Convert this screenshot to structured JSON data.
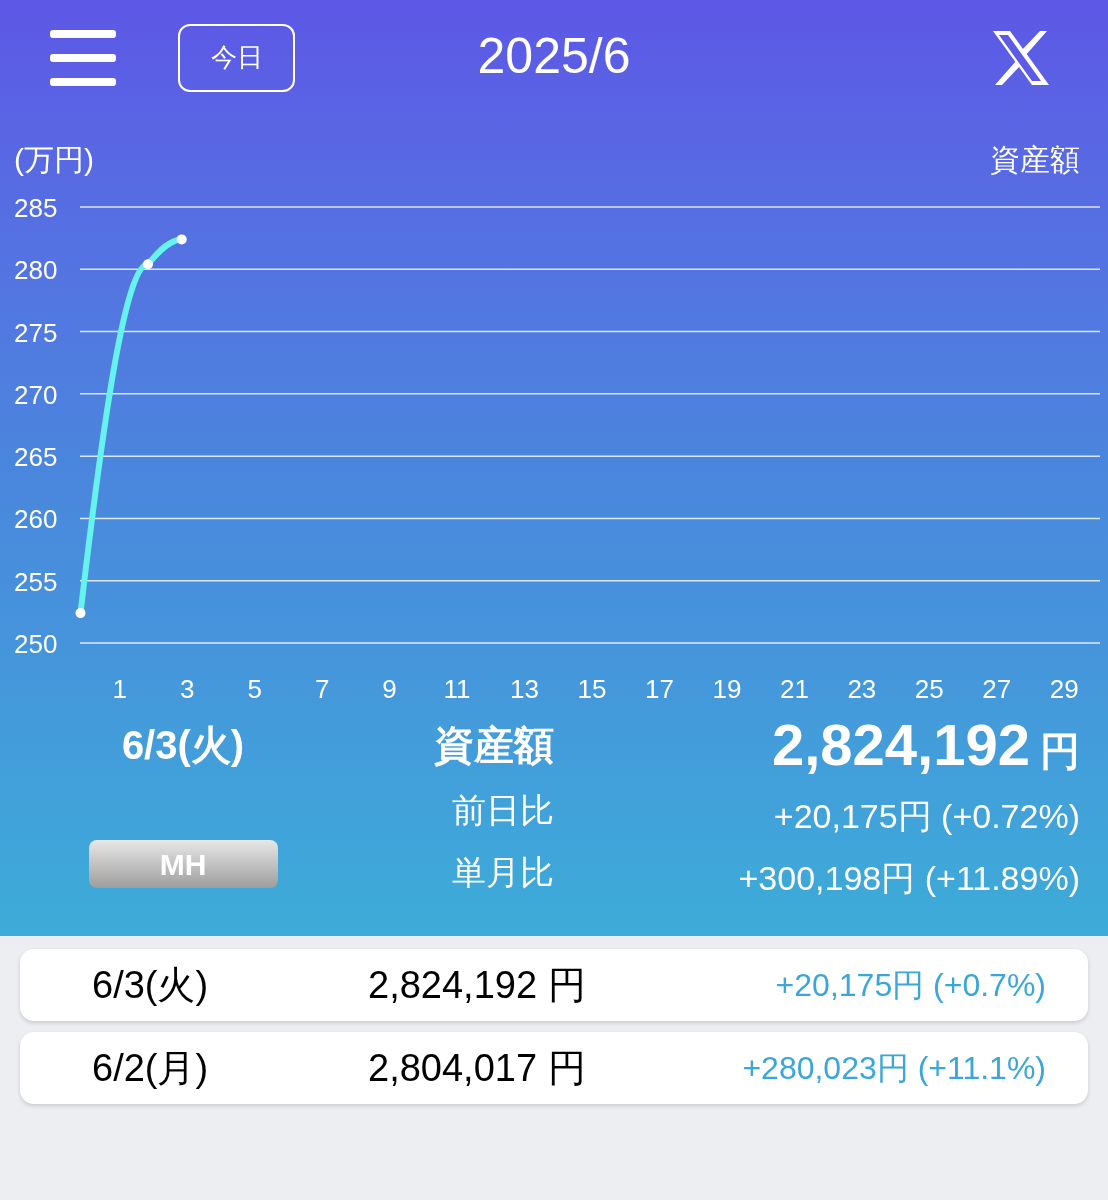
{
  "header": {
    "today_button": "今日",
    "title": "2025/6"
  },
  "chart": {
    "chart_data": {
      "type": "line",
      "ylabel": "(万円)",
      "x": [
        0,
        2,
        3
      ],
      "series": [
        {
          "name": "資産額",
          "color": "#66f2ee",
          "marker": "circle",
          "values": [
            252.4,
            280.4,
            282.4
          ]
        }
      ],
      "grid": true,
      "xlim": [
        0,
        30
      ],
      "ylim": [
        250,
        285
      ],
      "xticks": [
        1,
        3,
        5,
        7,
        9,
        11,
        13,
        15,
        17,
        19,
        21,
        23,
        25,
        27,
        29
      ],
      "yticks": [
        250,
        255,
        260,
        265,
        270,
        275,
        280,
        285
      ]
    }
  },
  "summary": {
    "date": "6/3(火)",
    "label": "資産額",
    "amount": "2,824,192",
    "currency": "円",
    "tag": "MH",
    "rows": [
      {
        "label": "前日比",
        "value": "+20,175円 (+0.72%)"
      },
      {
        "label": "単月比",
        "value": "+300,198円 (+11.89%)"
      }
    ]
  },
  "entries": [
    {
      "date": "6/3(火)",
      "amount": "2,824,192 円",
      "change": "+20,175円 (+0.7%)"
    },
    {
      "date": "6/2(月)",
      "amount": "2,804,017 円",
      "change": "+280,023円 (+11.1%)"
    }
  ]
}
